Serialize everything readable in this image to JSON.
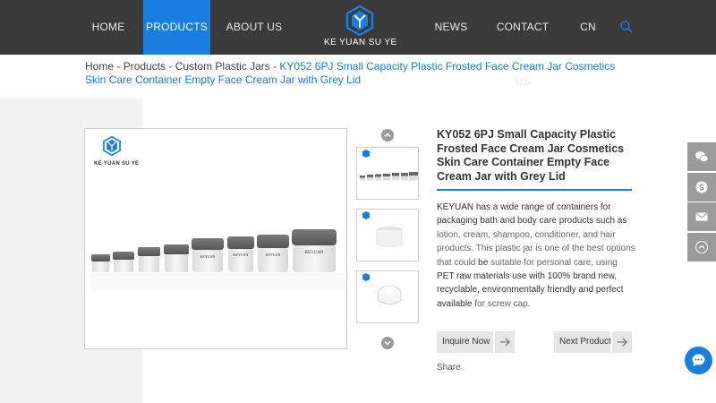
{
  "nav": {
    "items": [
      {
        "label": "HOME"
      },
      {
        "label": "PRODUCTS"
      },
      {
        "label": "ABOUT US"
      },
      {
        "label": "NEWS"
      },
      {
        "label": "CONTACT US"
      },
      {
        "label": "CN"
      }
    ],
    "active": "PRODUCTS",
    "logo_text": "KE YUAN SU YE",
    "search_icon": "search-icon"
  },
  "breadcrumb": {
    "items": [
      "Home",
      "Products",
      "Custom Plastic Jars"
    ],
    "separator": " - ",
    "current": "KY052 6PJ Small Capacity Plastic Frosted Face Cream Jar Cosmetics Skin Care Container Empty Face Cream Jar with Grey Lid"
  },
  "gallery": {
    "image_logo_text": "KE YUAN SU YE",
    "jar_label": "KEYUAN",
    "up_icon": "chevron-up-icon",
    "down_icon": "chevron-down-icon"
  },
  "product": {
    "title": "KY052 6PJ Small Capacity Plastic Frosted Face Cream Jar Cosmetics Skin Care Container Empty Face Cream Jar with Grey Lid",
    "description": {
      "p1": "KEYUAN has a wide range of containers for packaging bath and body care products such as ",
      "p2": "lotion,",
      "p3": " cream, shampoo, conditioner, and hair products. ",
      "p4": "This plastic jar is one of the best options that could",
      "p5": " be ",
      "p6": "suitable for personal care, using ",
      "p7": "PET raw materials use with 100% brand new, recyclable, environmentally friendly and perfect available ",
      "p8": "for screw cap."
    },
    "inquire_label": "Inquire Now",
    "next_label": "Next Product",
    "share_label": "Share"
  },
  "side_bar": {
    "icons": [
      "wechat-icon",
      "skype-icon",
      "email-icon",
      "back-to-top-icon"
    ]
  },
  "chat": {
    "icon": "chat-icon"
  },
  "colors": {
    "nav_bg": "#3a3a3a",
    "accent": "#1a7de0",
    "side_bar": "#9b9b9b",
    "lid_grey": "#6a6a6a"
  }
}
